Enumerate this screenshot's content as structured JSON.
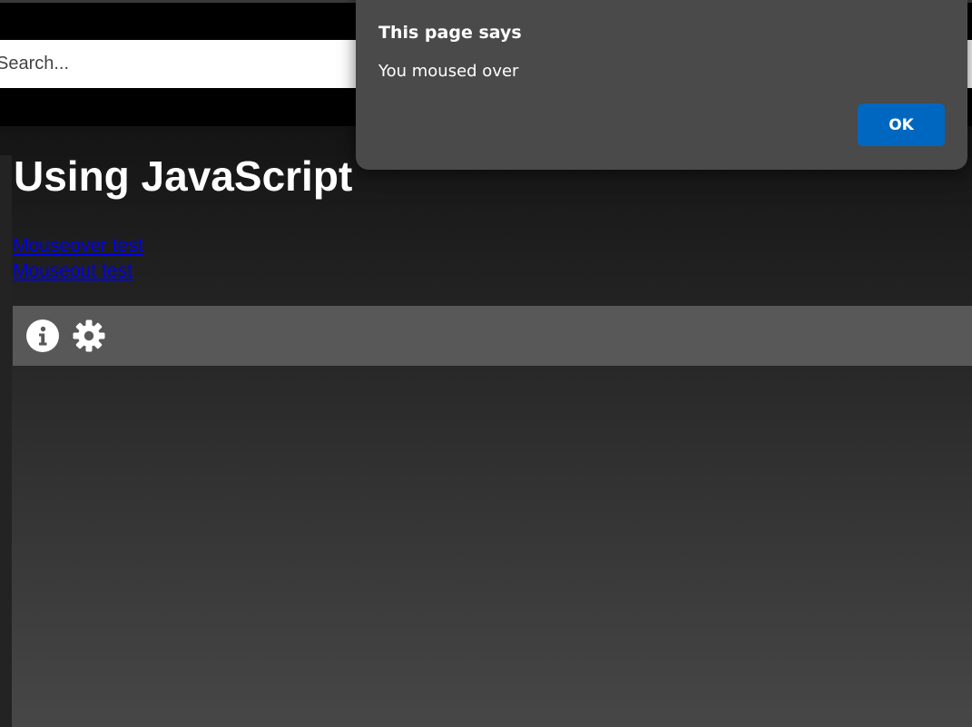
{
  "search": {
    "placeholder": "Search..."
  },
  "page": {
    "title": "Using JavaScript",
    "links": [
      {
        "label": "Mouseover test"
      },
      {
        "label": "Mouseout test"
      }
    ]
  },
  "toolbar": {
    "icons": [
      "info-icon",
      "gear-icon"
    ]
  },
  "dialog": {
    "title": "This page says",
    "message": "You moused over",
    "ok_label": "OK"
  },
  "colors": {
    "link": "#0000ee",
    "dialog_bg": "#4a4a4a",
    "ok_button": "#0067c0",
    "toolbar_bg": "#585858"
  }
}
